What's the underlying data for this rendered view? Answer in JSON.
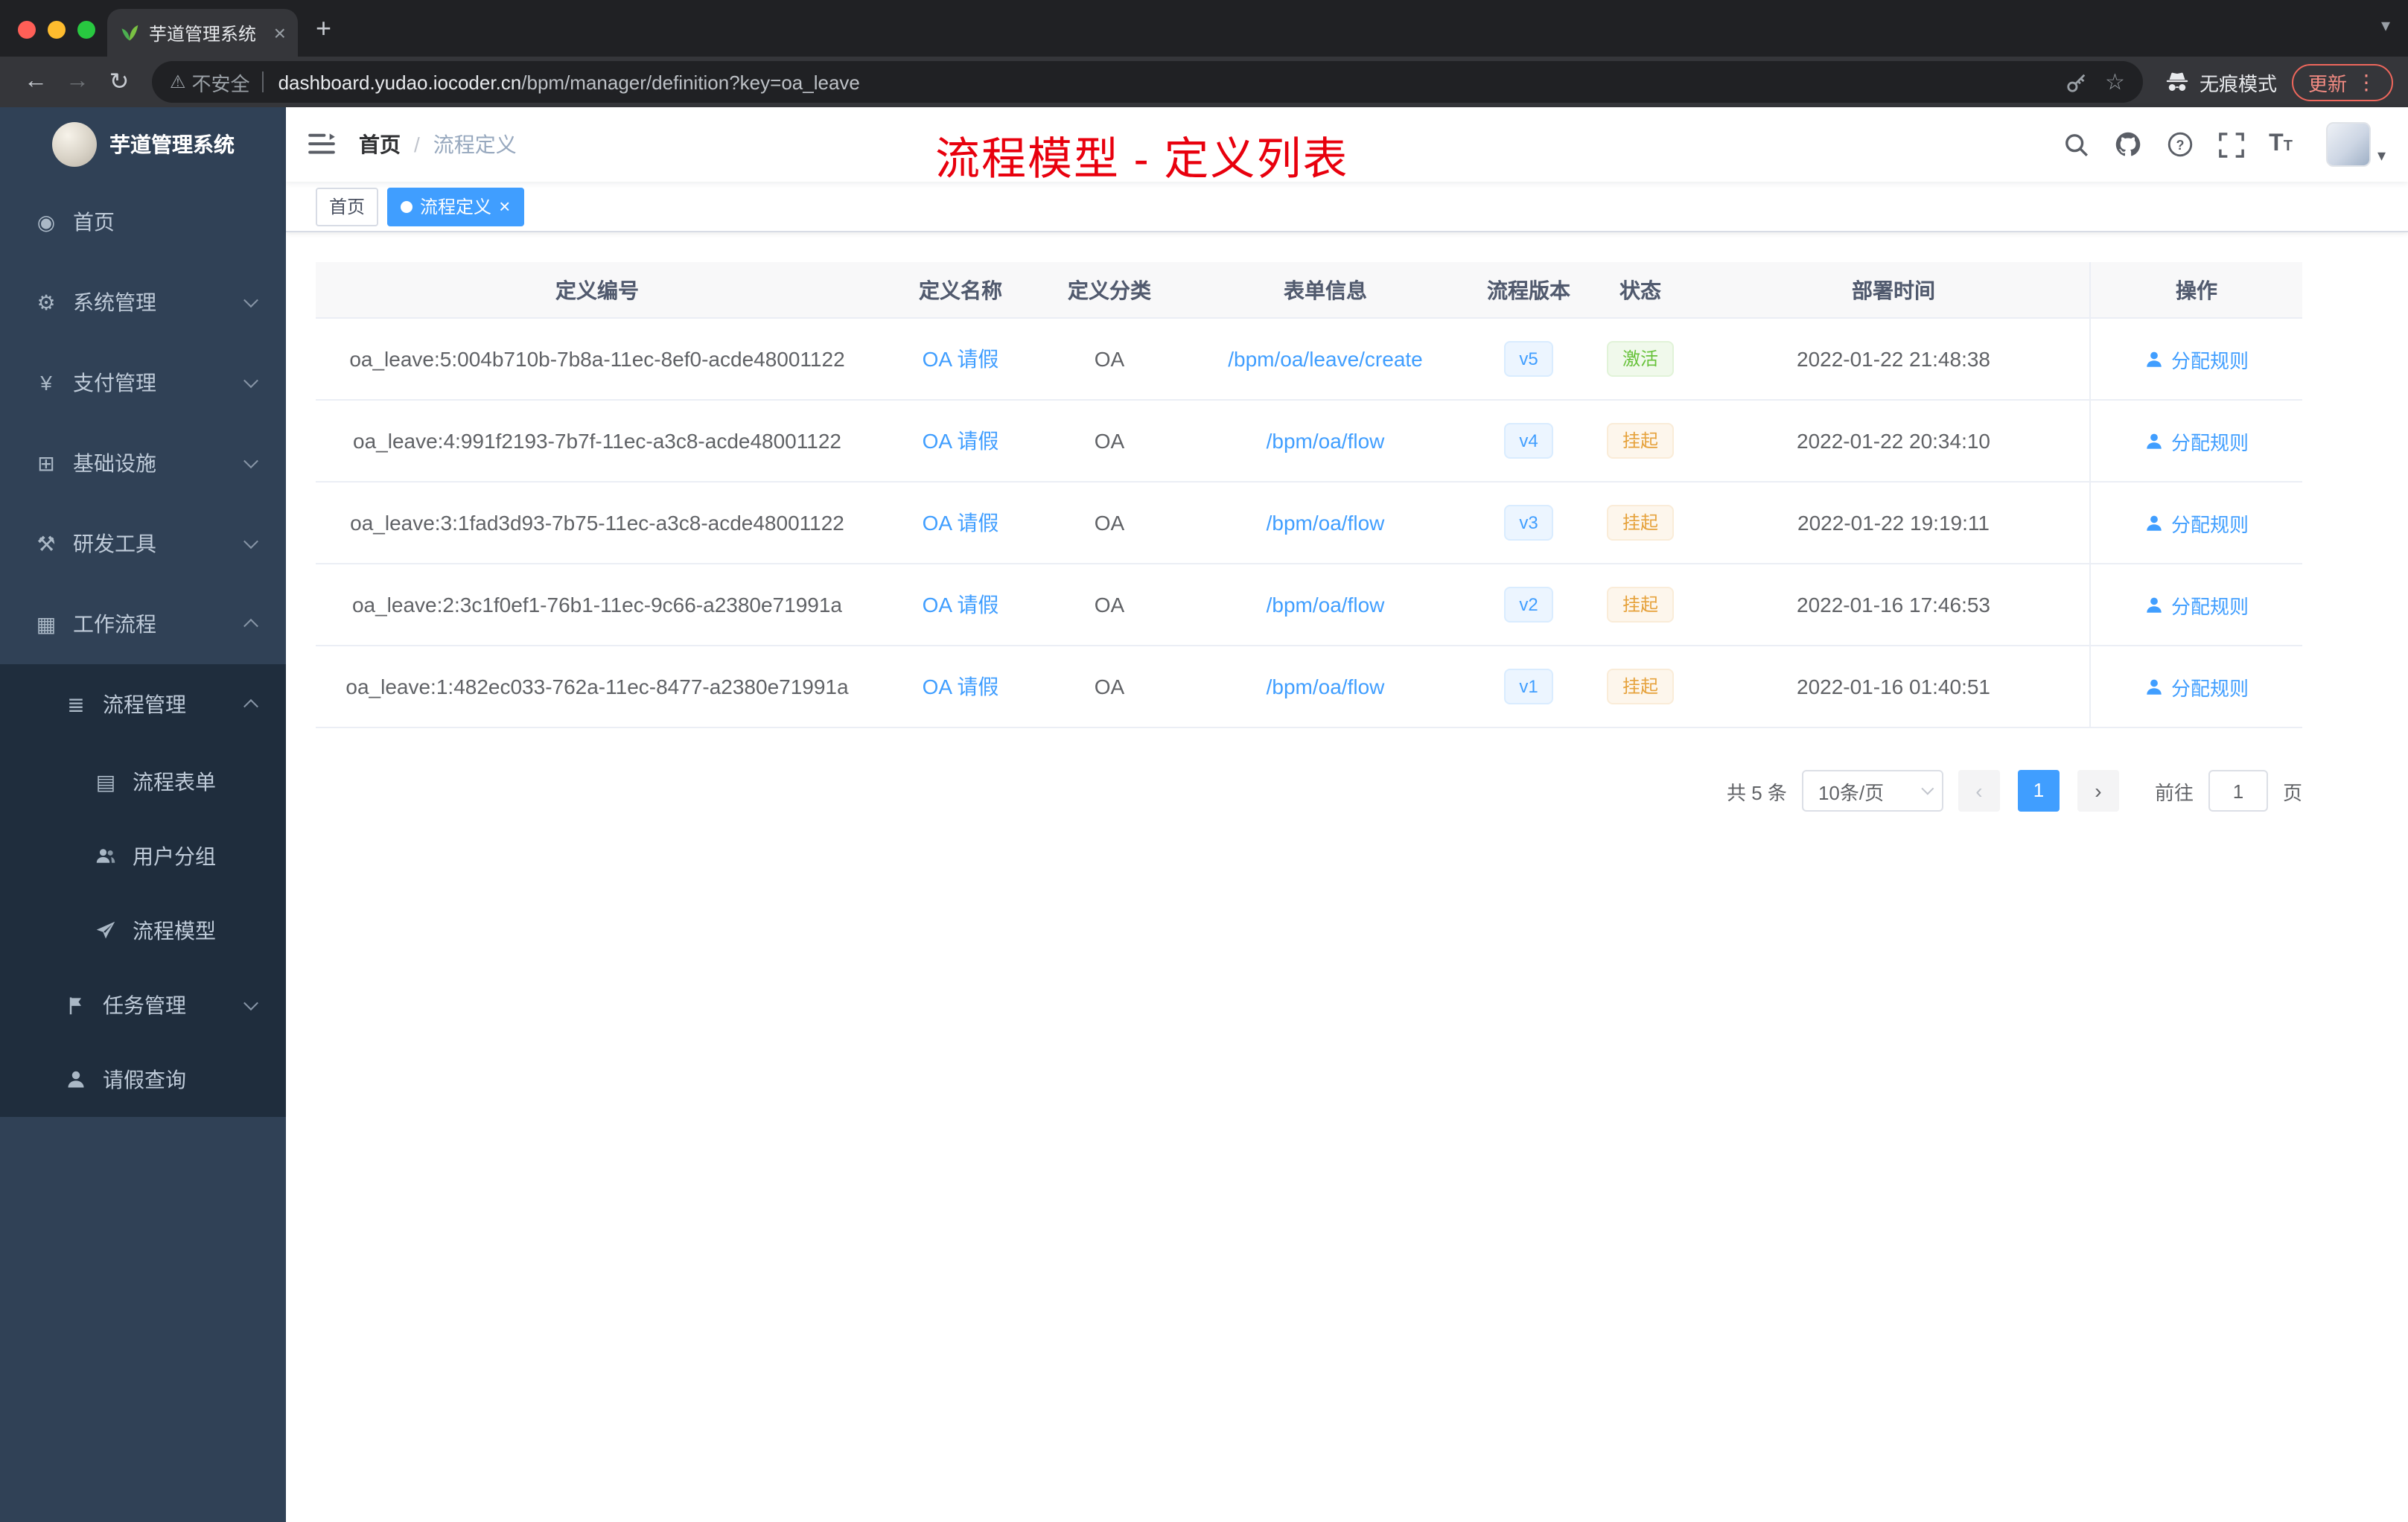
{
  "colors": {
    "primary": "#409eff",
    "success": "#67c23a",
    "warning": "#e6a23c",
    "annotation_red": "#e8000d",
    "sidebar_bg": "#304156",
    "sidebar_submenu_bg": "#1f2d3d"
  },
  "browser": {
    "tab_title": "芋道管理系统",
    "security_label": "不安全",
    "url_host": "dashboard.yudao.iocoder.cn",
    "url_path": "/bpm/manager/definition?key=oa_leave",
    "incognito_label": "无痕模式",
    "update_label": "更新"
  },
  "sidebar": {
    "logo_title": "芋道管理系统",
    "menu": [
      {
        "label": "首页",
        "glyph": "◉"
      },
      {
        "label": "系统管理",
        "glyph": "⚙"
      },
      {
        "label": "支付管理",
        "glyph": "¥"
      },
      {
        "label": "基础设施",
        "glyph": "⊞"
      },
      {
        "label": "研发工具",
        "glyph": "⚒"
      },
      {
        "label": "工作流程",
        "glyph": "▦"
      }
    ],
    "submenu": {
      "process_mgmt": {
        "label": "流程管理",
        "glyph": "≣"
      },
      "process_form": {
        "label": "流程表单",
        "glyph": "▤"
      },
      "user_group": {
        "label": "用户分组"
      },
      "process_model": {
        "label": "流程模型"
      },
      "task_mgmt": {
        "label": "任务管理"
      },
      "leave_query": {
        "label": "请假查询"
      }
    }
  },
  "header": {
    "breadcrumb_home": "首页",
    "breadcrumb_current": "流程定义",
    "annotation": "流程模型 - 定义列表"
  },
  "tags": {
    "home": "首页",
    "active": "流程定义"
  },
  "table": {
    "columns": [
      "定义编号",
      "定义名称",
      "定义分类",
      "表单信息",
      "流程版本",
      "状态",
      "部署时间",
      "操作"
    ],
    "rows": [
      {
        "id": "oa_leave:5:004b710b-7b8a-11ec-8ef0-acde48001122",
        "name": "OA 请假",
        "category": "OA",
        "form": "/bpm/oa/leave/create",
        "version": "v5",
        "status": "激活",
        "time": "2022-01-22 21:48:38",
        "action": "分配规则"
      },
      {
        "id": "oa_leave:4:991f2193-7b7f-11ec-a3c8-acde48001122",
        "name": "OA 请假",
        "category": "OA",
        "form": "/bpm/oa/flow",
        "version": "v4",
        "status": "挂起",
        "time": "2022-01-22 20:34:10",
        "action": "分配规则"
      },
      {
        "id": "oa_leave:3:1fad3d93-7b75-11ec-a3c8-acde48001122",
        "name": "OA 请假",
        "category": "OA",
        "form": "/bpm/oa/flow",
        "version": "v3",
        "status": "挂起",
        "time": "2022-01-22 19:19:11",
        "action": "分配规则"
      },
      {
        "id": "oa_leave:2:3c1f0ef1-76b1-11ec-9c66-a2380e71991a",
        "name": "OA 请假",
        "category": "OA",
        "form": "/bpm/oa/flow",
        "version": "v2",
        "status": "挂起",
        "time": "2022-01-16 17:46:53",
        "action": "分配规则"
      },
      {
        "id": "oa_leave:1:482ec033-762a-11ec-8477-a2380e71991a",
        "name": "OA 请假",
        "category": "OA",
        "form": "/bpm/oa/flow",
        "version": "v1",
        "status": "挂起",
        "time": "2022-01-16 01:40:51",
        "action": "分配规则"
      }
    ]
  },
  "pagination": {
    "total": "共 5 条",
    "page_size": "10条/页",
    "current_page": "1",
    "goto_label": "前往",
    "goto_value": "1",
    "page_unit": "页"
  },
  "icons": {
    "tab-favicon": "green-leaf",
    "security-warning-icon": "⚠",
    "bookmark-star-icon": "☆",
    "browser-menu-icon": "⋮",
    "font-size-icon": "T"
  }
}
